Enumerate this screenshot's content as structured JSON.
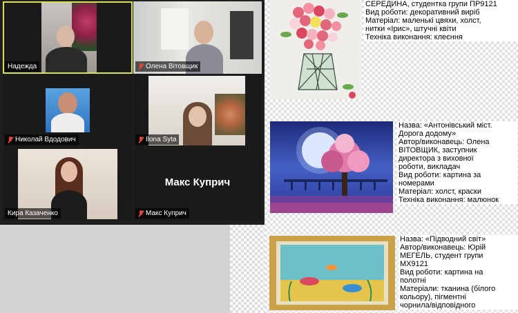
{
  "participants": [
    {
      "name": "Надежда",
      "muted": false,
      "active": true
    },
    {
      "name": "Олена Вітовщик",
      "muted": true
    },
    {
      "name": "Николай Вдодович",
      "muted": true
    },
    {
      "name": "Ilona Syta",
      "muted": true
    },
    {
      "name": "Кира Казаченко",
      "muted": false
    },
    {
      "name": "Макс Куприч",
      "muted": true,
      "display_text": "Макс Куприч"
    }
  ],
  "colors": {
    "active_speaker": "#d8e257",
    "muted_icon": "#e0453a"
  },
  "document": {
    "entry1": {
      "lines": [
        "СЕРЕДИНА, студентка групи ПР9121",
        "Вид роботи: декоративний виріб",
        "Матеріал: маленькі цвяхи, холст,",
        "нитки «Ірис», штучні квіти",
        "Техніка виконання: клеєння"
      ]
    },
    "entry2": {
      "lines": [
        "Назва: «Антонівський міст.",
        "Дорога додому»",
        "Автор/виконавець: Олена",
        "ВІТОВЩИК, заступник",
        "директора з виховної",
        "роботи, викладач",
        "Вид роботи: картина за",
        "номерами",
        "Матеріал: холст, краски",
        "Техніка виконання: малюнок"
      ]
    },
    "entry3": {
      "lines": [
        "Назва: «Підводний світ»",
        "Автор/виконавець: Юрій",
        "МЕГЕЛЬ, студент групи",
        "МХ9121",
        "Вид роботи: картина на",
        "полотні",
        "Матеріали: тканина (білого",
        "кольору), пігментні",
        "чорнила/відповідного"
      ]
    }
  }
}
